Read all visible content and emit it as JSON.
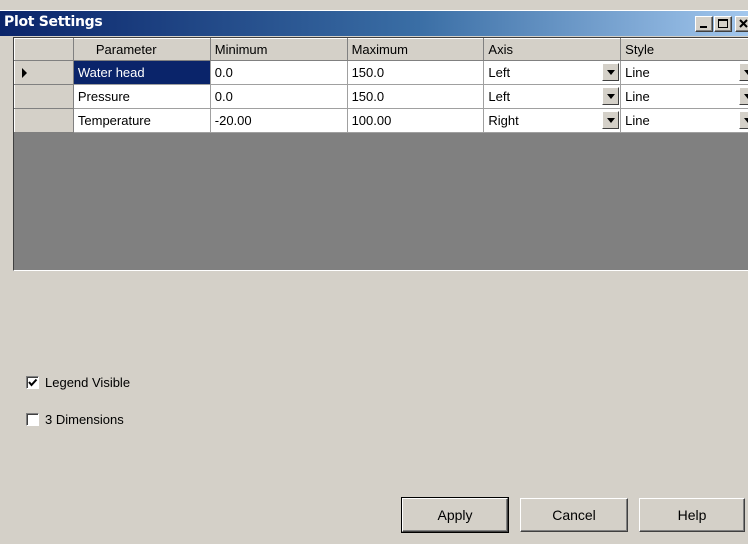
{
  "window": {
    "title": "Plot Settings",
    "minimize_icon": "minimize-icon",
    "maximize_icon": "maximize-icon",
    "close_icon": "close-icon"
  },
  "grid": {
    "columns": [
      "Parameter",
      "Minimum",
      "Maximum",
      "Axis",
      "Style"
    ],
    "rows": [
      {
        "parameter": "Water head",
        "minimum": "0.0",
        "maximum": "150.0",
        "axis": "Left",
        "style": "Line",
        "current": true
      },
      {
        "parameter": "Pressure",
        "minimum": "0.0",
        "maximum": "150.0",
        "axis": "Left",
        "style": "Line",
        "current": false
      },
      {
        "parameter": "Temperature",
        "minimum": "-20.00",
        "maximum": "100.00",
        "axis": "Right",
        "style": "Line",
        "current": false
      }
    ]
  },
  "options": {
    "legend_visible": {
      "label": "Legend Visible",
      "checked": true
    },
    "three_dimensions": {
      "label": "3 Dimensions",
      "checked": false
    }
  },
  "buttons": {
    "apply": "Apply",
    "cancel": "Cancel",
    "help": "Help"
  },
  "colors": {
    "title_bar": "#0a246a",
    "selection": "#0a246a",
    "face": "#d4d0c8"
  }
}
